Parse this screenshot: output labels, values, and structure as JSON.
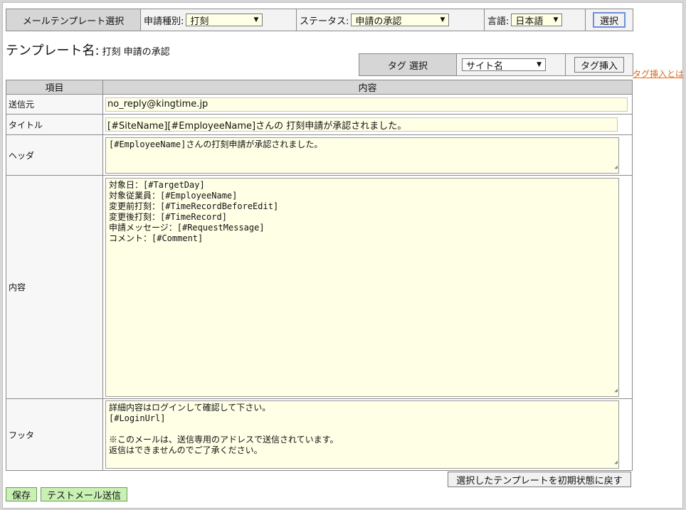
{
  "selector": {
    "header": "メールテンプレート選択",
    "application_type_label": "申請種別:",
    "application_type_value": "打刻",
    "status_label": "ステータス:",
    "status_value": "申請の承認",
    "language_label": "言語:",
    "language_value": "日本語",
    "select_button": "選択"
  },
  "template": {
    "name_label": "テンプレート名:",
    "name_value": "打刻 申請の承認"
  },
  "tag": {
    "header": "タグ 選択",
    "dropdown_value": "サイト名",
    "insert_button": "タグ挿入",
    "help_link": "タグ挿入とは"
  },
  "table": {
    "col_item": "項目",
    "col_content": "内容",
    "rows": {
      "sender": {
        "label": "送信元",
        "value": "no_reply@kingtime.jp"
      },
      "title": {
        "label": "タイトル",
        "value": "[#SiteName][#EmployeeName]さんの 打刻申請が承認されました。"
      },
      "header": {
        "label": "ヘッダ",
        "value": "[#EmployeeName]さんの打刻申請が承認されました。"
      },
      "body": {
        "label": "内容",
        "value": "対象日：[#TargetDay]\n対象従業員：[#EmployeeName]\n変更前打刻：[#TimeRecordBeforeEdit]\n変更後打刻：[#TimeRecord]\n申請メッセージ：[#RequestMessage]\nコメント：[#Comment]"
      },
      "footer": {
        "label": "フッタ",
        "value": "詳細内容はログインして確認して下さい。\n[#LoginUrl]\n\n※このメールは、送信専用のアドレスで送信されています。\n返信はできませんのでご了承ください。"
      }
    }
  },
  "actions": {
    "reset_button": "選択したテンプレートを初期状態に戻す",
    "save_button": "保存",
    "test_mail_button": "テストメール送信"
  }
}
